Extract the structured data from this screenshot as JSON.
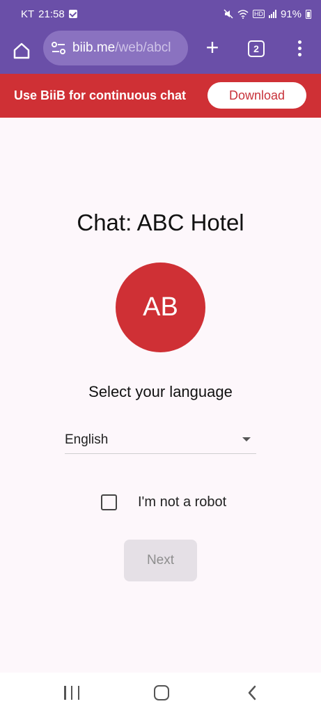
{
  "status_bar": {
    "carrier": "KT",
    "time": "21:58",
    "battery": "91%",
    "network_badge": "HD"
  },
  "browser": {
    "url_host": "biib.me",
    "url_path": "/web/abcl",
    "tab_count": "2"
  },
  "banner": {
    "text": "Use BiiB for continuous chat",
    "button_label": "Download"
  },
  "main": {
    "title": "Chat: ABC Hotel",
    "avatar_initials": "AB",
    "language_label": "Select your language",
    "language_selected": "English",
    "robot_label": "I'm not a robot",
    "next_label": "Next"
  },
  "colors": {
    "toolbar": "#6a4fa8",
    "banner": "#cf3035",
    "avatar": "#cf3035",
    "background": "#fdf7fb"
  }
}
